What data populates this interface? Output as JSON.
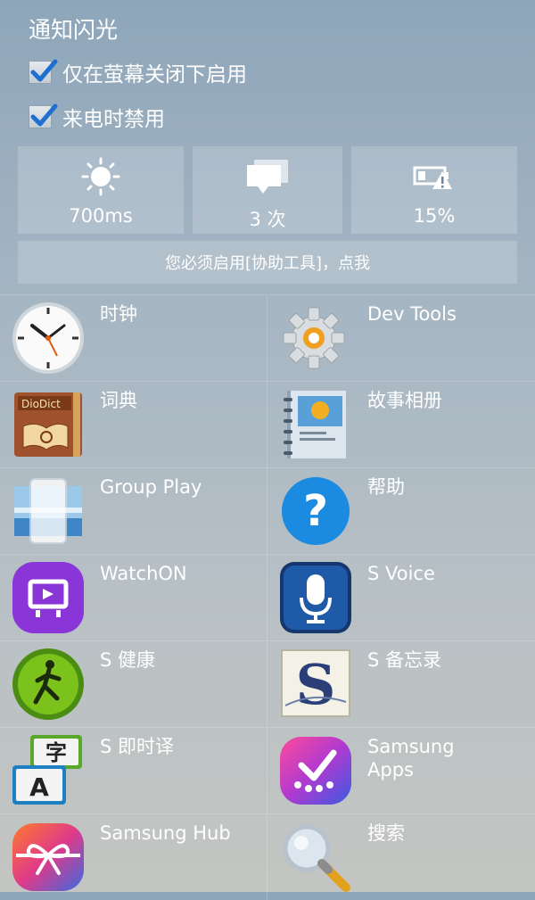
{
  "header": {
    "title": "通知闪光"
  },
  "options": [
    {
      "label": "仅在萤幕关闭下启用",
      "checked": true
    },
    {
      "label": "来电时禁用",
      "checked": true
    }
  ],
  "tiles": [
    {
      "icon": "sun-icon",
      "value": "700ms"
    },
    {
      "icon": "messages-icon",
      "value": "3 次"
    },
    {
      "icon": "battery-warning-icon",
      "value": "15%"
    }
  ],
  "notice": "您必须启用[协助工具]，点我",
  "apps": [
    {
      "label": "时钟",
      "icon": "clock-icon"
    },
    {
      "label": "Dev Tools",
      "icon": "dev-tools-gear-icon"
    },
    {
      "label": "词典",
      "icon": "dictionary-book-icon"
    },
    {
      "label": "故事相册",
      "icon": "story-album-icon"
    },
    {
      "label": "Group Play",
      "icon": "group-play-icon"
    },
    {
      "label": "帮助",
      "icon": "help-question-icon"
    },
    {
      "label": "WatchON",
      "icon": "watchon-tv-icon"
    },
    {
      "label": "S Voice",
      "icon": "s-voice-mic-icon"
    },
    {
      "label": "S 健康",
      "icon": "s-health-runner-icon"
    },
    {
      "label": "S 备忘录",
      "icon": "s-memo-icon"
    },
    {
      "label": "S 即时译",
      "icon": "s-translator-icon"
    },
    {
      "label": "Samsung\nApps",
      "icon": "samsung-apps-icon"
    },
    {
      "label": "Samsung Hub",
      "icon": "samsung-hub-icon"
    },
    {
      "label": "搜索",
      "icon": "search-magnifier-icon"
    }
  ],
  "colors": {
    "accent_blue": "#1f6fd1",
    "help_blue": "#1a8be0",
    "watchon_purple": "#8a35d8",
    "health_green": "#7cc21d"
  }
}
